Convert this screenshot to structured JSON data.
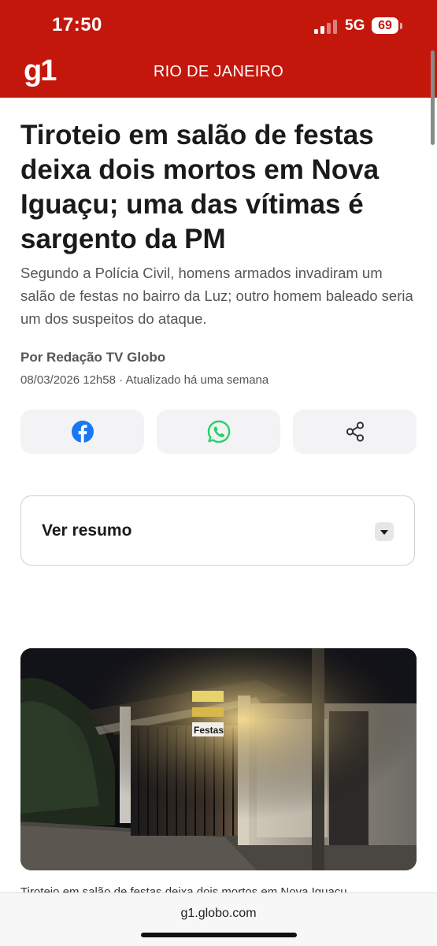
{
  "status_bar": {
    "time": "17:50",
    "network": "5G",
    "battery": "69"
  },
  "header": {
    "logo": "g1",
    "section": "RIO DE JANEIRO"
  },
  "article": {
    "title": "Tiroteio em salão de festas deixa dois mortos em Nova Iguaçu; uma das vítimas é sargento da PM",
    "subtitle": "Segundo a Polícia Civil, homens armados invadiram um salão de festas no bairro da Luz; outro homem baleado seria um dos suspeitos do ataque.",
    "byline": "Por Redação TV Globo",
    "dateline": "08/03/2026 12h58 · Atualizado há uma semana",
    "summary_label": "Ver resumo",
    "photo_sign_1": "Festas",
    "caption_partial": "Tiroteio em salão de festas deixa dois mortos em Nova Iguaçu"
  },
  "share": [
    {
      "icon": "facebook-icon",
      "color": "#1877f2"
    },
    {
      "icon": "whatsapp-icon",
      "color": "#25d366"
    },
    {
      "icon": "share-icon",
      "color": "#333333"
    }
  ],
  "browser": {
    "url": "g1.globo.com"
  },
  "colors": {
    "brand": "#c4170c"
  }
}
